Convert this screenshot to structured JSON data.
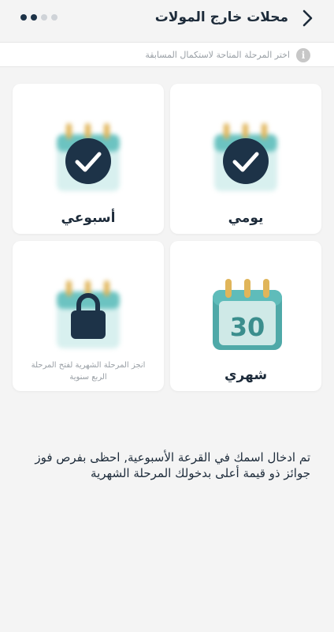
{
  "header": {
    "title": "محلات خارج المولات",
    "back_icon": "chevron-right-icon",
    "progress_dots": {
      "total": 4,
      "active": 2
    }
  },
  "info": {
    "text": "اختر المرحلة المتاحة لاستكمال المسابقة",
    "icon": "info-icon"
  },
  "stages": {
    "daily": {
      "label": "يومي",
      "status": "completed"
    },
    "weekly": {
      "label": "أسبوعي",
      "status": "completed"
    },
    "monthly": {
      "label": "شهري",
      "status": "available",
      "calendar_number": "30"
    },
    "quarterly": {
      "label": "",
      "status": "locked",
      "locked_text": "انجز المرحلة الشهرية لفتح المرحلة الربع سنوية"
    }
  },
  "description": "تم ادخال اسمك في القرعة الأسبوعية, احظى بفرص فوز جوائز ذو قيمة أعلى بدخولك المرحلة الشهرية",
  "colors": {
    "background": "#f4f4f4",
    "card": "#ffffff",
    "dark": "#1d3348",
    "teal": "#5bb8b8",
    "ring": "#e0b55a"
  }
}
